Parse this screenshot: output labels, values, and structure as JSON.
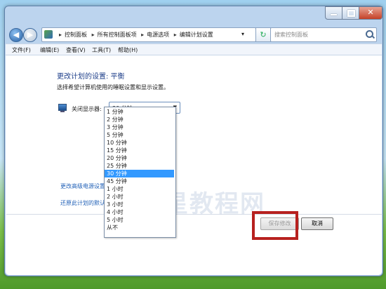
{
  "address": {
    "crumbs": [
      "控制面板",
      "所有控制面板项",
      "电源选项",
      "编辑计划设置"
    ],
    "separator": "▸"
  },
  "search": {
    "placeholder": "搜索控制面板"
  },
  "menu": [
    "文件(F)",
    "编辑(E)",
    "查看(V)",
    "工具(T)",
    "帮助(H)"
  ],
  "page": {
    "title": "更改计划的设置: 平衡",
    "subtitle": "选择希望计算机使用的睡眠设置和显示设置。",
    "display_label": "关闭显示器:",
    "display_value": "30 分钟",
    "link_advanced": "更改高级电源设置(",
    "link_restore": "还原此计划的默认设"
  },
  "dropdown": {
    "options": [
      "1 分钟",
      "2 分钟",
      "3 分钟",
      "5 分钟",
      "10 分钟",
      "15 分钟",
      "20 分钟",
      "25 分钟",
      "30 分钟",
      "45 分钟",
      "1 小时",
      "2 小时",
      "3 小时",
      "4 小时",
      "5 小时",
      "从不"
    ],
    "selected_index": 8
  },
  "buttons": {
    "save": "保存修改",
    "cancel": "取消"
  },
  "watermark": "木星教程网",
  "colors": {
    "highlight": "#b7211f",
    "selected": "#3399ff",
    "link": "#2463b8"
  }
}
